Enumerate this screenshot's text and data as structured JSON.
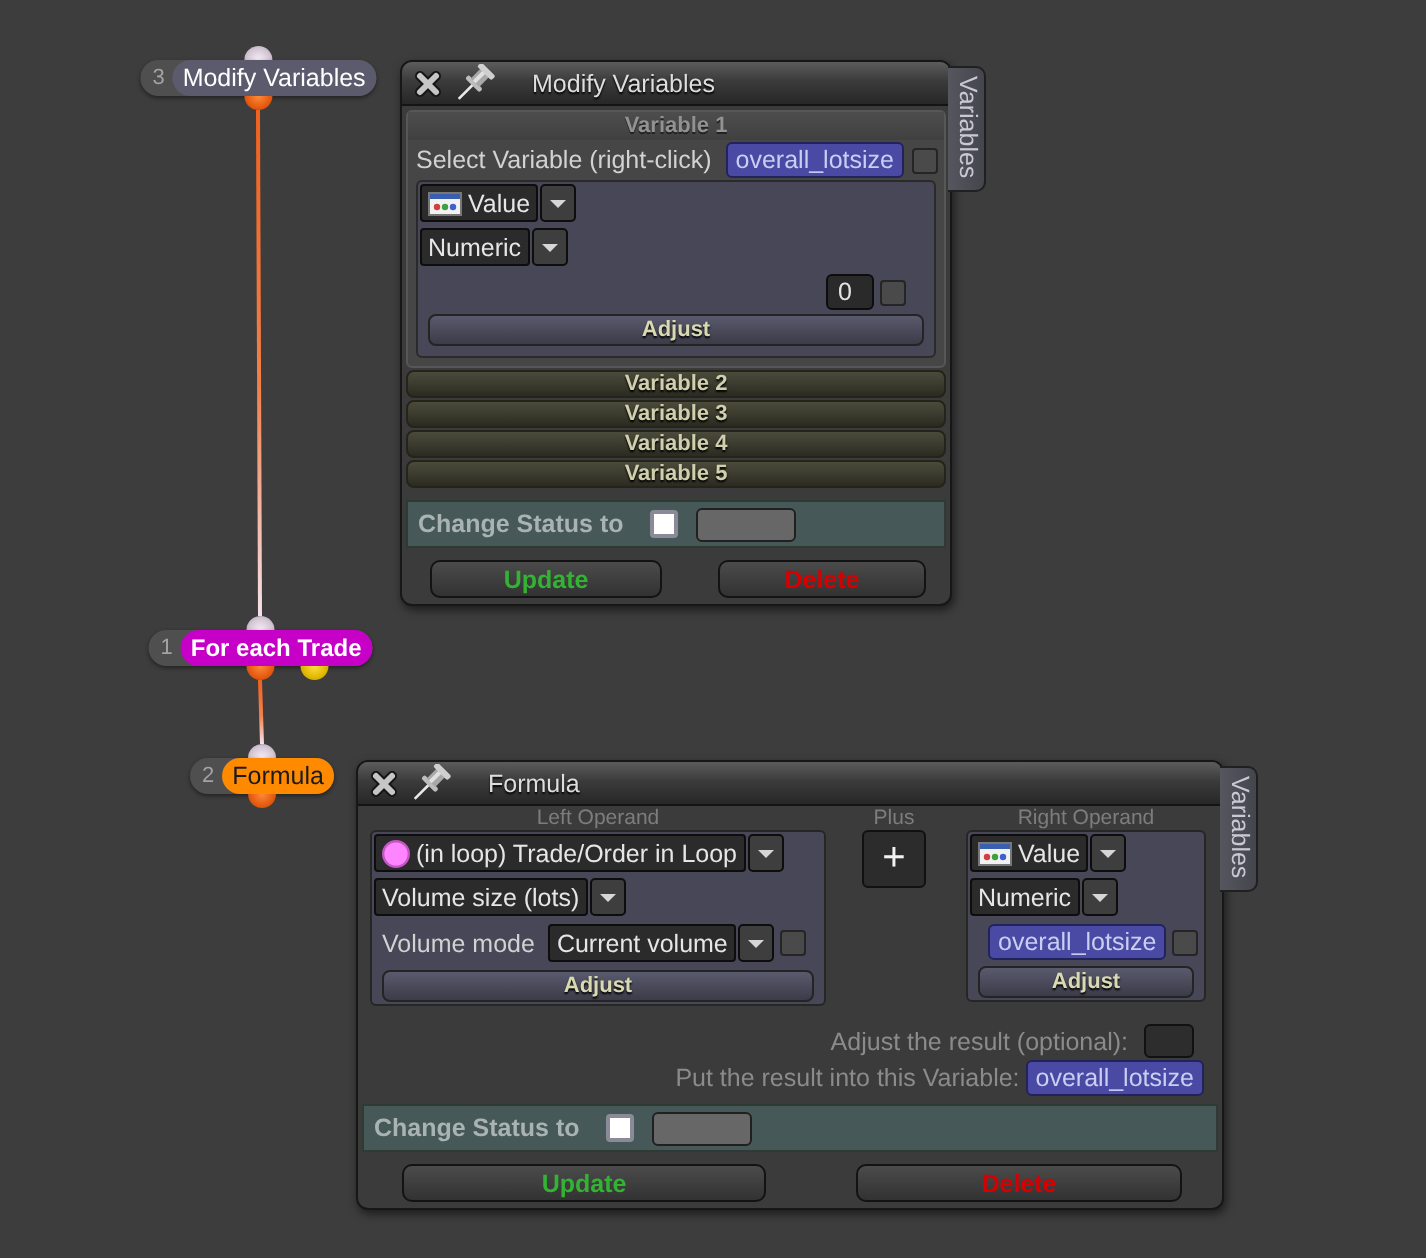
{
  "nodes": [
    {
      "number": "3",
      "label": "Modify Variables",
      "color": "#5b5b6d",
      "kind": "action"
    },
    {
      "number": "1",
      "label": "For each Trade",
      "color": "#c600c6",
      "kind": "loop"
    },
    {
      "number": "2",
      "label": "Formula",
      "color": "#ff8a00",
      "kind": "action"
    }
  ],
  "modify_variables_panel": {
    "title": "Modify Variables",
    "side_tab": "Variables",
    "variables": [
      {
        "header": "Variable 1",
        "expanded": true,
        "select_label": "Select Variable (right-click)",
        "variable": "overall_lotsize",
        "variable_checked": false,
        "type": "Value",
        "format": "Numeric",
        "value": "0",
        "value_checked": false,
        "adjust_button": "Adjust"
      },
      {
        "header": "Variable 2",
        "expanded": false
      },
      {
        "header": "Variable 3",
        "expanded": false
      },
      {
        "header": "Variable 4",
        "expanded": false
      },
      {
        "header": "Variable 5",
        "expanded": false
      }
    ],
    "change_status": {
      "label": "Change Status to",
      "checked": false
    },
    "buttons": [
      {
        "label": "Update",
        "kind": "update"
      },
      {
        "label": "Delete",
        "kind": "delete"
      }
    ]
  },
  "formula_panel": {
    "title": "Formula",
    "side_tab": "Variables",
    "left_operand": {
      "label": "Left Operand",
      "source": "(in loop) Trade/Order in Loop",
      "property": "Volume size (lots)",
      "mode_label": "Volume mode",
      "mode": "Current volume",
      "mode_checked": false,
      "adjust_button": "Adjust"
    },
    "operator": {
      "label": "Plus",
      "symbol": "+"
    },
    "right_operand": {
      "label": "Right Operand",
      "type": "Value",
      "format": "Numeric",
      "variable": "overall_lotsize",
      "variable_checked": false,
      "adjust_button": "Adjust"
    },
    "adjust_result": {
      "label": "Adjust the result (optional):"
    },
    "result_variable": {
      "label": "Put the result into this Variable:",
      "value": "overall_lotsize"
    },
    "change_status": {
      "label": "Change Status to",
      "checked": false
    },
    "buttons": [
      {
        "label": "Update",
        "kind": "update"
      },
      {
        "label": "Delete",
        "kind": "delete"
      }
    ]
  }
}
